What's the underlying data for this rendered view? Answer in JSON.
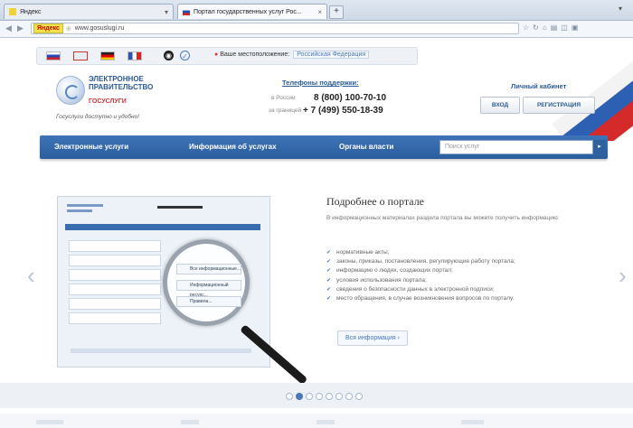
{
  "browser": {
    "tabs": [
      {
        "label": "Яндекс",
        "active": false
      },
      {
        "label": "Портал государственных услуг Рос...",
        "active": true
      }
    ],
    "new_tab": "+",
    "url_badge": "Яндекс",
    "url": "www.gosuslugi.ru"
  },
  "site": {
    "top": {
      "location_label": "Ваше местоположение:",
      "region": "Российская Федерация"
    },
    "logo": {
      "line1": "ЭЛЕКТРОННОЕ",
      "line2": "ПРАВИТЕЛЬСТВО",
      "line3": "ГОСУСЛУГИ",
      "tagline": "Госуслуги доступно и удобно!"
    },
    "support": {
      "title": "Телефоны поддержки:",
      "phone1_label": "в России",
      "phone1": "8 (800) 100-70-10",
      "phone2_label": "за границей",
      "phone2": "+ 7 (499) 550-18-39"
    },
    "cabinet": {
      "title": "Личный кабинет",
      "login": "ВХОД",
      "register": "РЕГИСТРАЦИЯ"
    },
    "menu": {
      "items": [
        "Электронные услуги",
        "Информация об услугах",
        "Органы власти"
      ],
      "search_placeholder": "Поиск услуг"
    },
    "slide": {
      "title": "Подробнее о портале",
      "description": "В информационных материалах раздела портала вы можете получить информацию:",
      "bullets": [
        "нормативные акты;",
        "законы, приказы, постановления, регулирующие работу портала;",
        "информацию о людях, создающих портал;",
        "условия использования портала;",
        "сведения о безопасности данных в электронной подписи;",
        "место обращения, в случае возникновения вопросов по порталу."
      ],
      "more_button": "Вся информация ›",
      "preview": {
        "lens_rows": [
          "Все информационные...",
          "Информационный ресурс...",
          "Правила..."
        ]
      }
    },
    "carousel": {
      "prev": "‹",
      "next": "›",
      "active_dot": 1,
      "dot_count": 8
    },
    "colors": {
      "primary": "#2a5d9e",
      "accent": "#4a79b8",
      "red": "#cc3333"
    }
  }
}
